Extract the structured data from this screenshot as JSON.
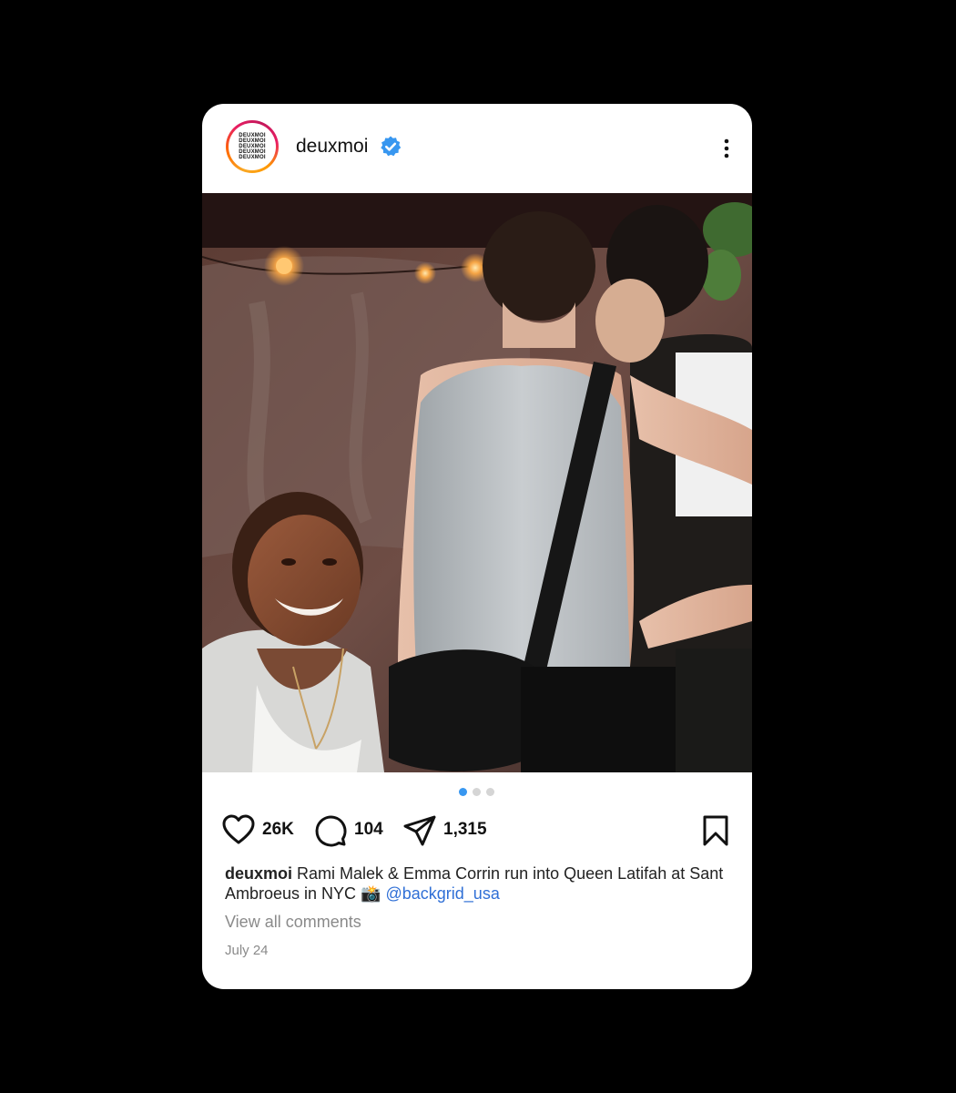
{
  "post": {
    "avatar_text_lines": [
      "DEUXMOI",
      "DEUXMOI",
      "DEUXMOI",
      "DEUXMOI",
      "DEUXMOI"
    ],
    "username": "deuxmoi",
    "verified_icon": "verified-badge-icon",
    "more_icon": "more-vertical-icon",
    "carousel": {
      "total": 3,
      "active_index": 0
    },
    "actions": {
      "likes": "26K",
      "comments": "104",
      "shares": "1,315"
    },
    "caption": {
      "user": "deuxmoi",
      "text": "Rami Malek & Emma Corrin run into Queen Latifah at Sant Ambroeus in NYC 📸",
      "mention": "@backgrid_usa"
    },
    "view_comments": "View all comments",
    "date": "July 24"
  },
  "colors": {
    "background": "#000000",
    "card": "#ffffff",
    "accent_blue": "#3897f0",
    "mention_blue": "#2f6fd6",
    "muted_text": "#8a8a8a"
  }
}
